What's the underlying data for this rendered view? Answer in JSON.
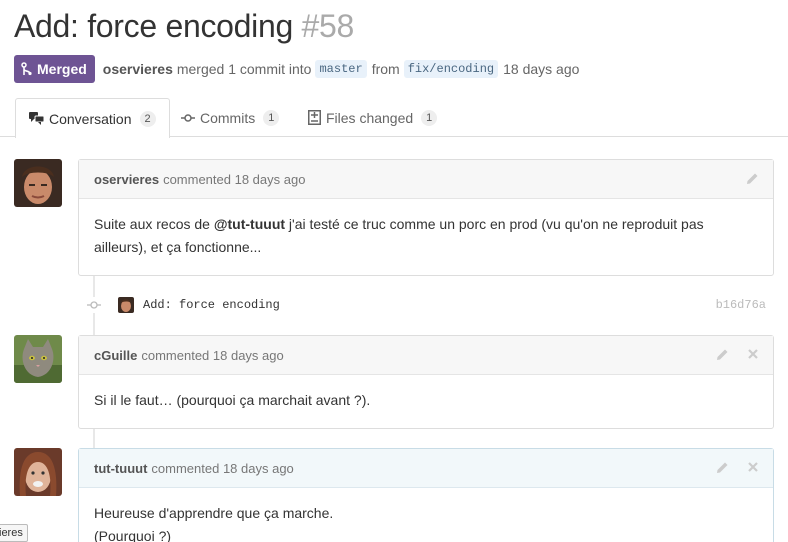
{
  "header": {
    "title": "Add: force encoding",
    "number": "#58"
  },
  "pr_meta": {
    "state": "Merged",
    "author": "oservieres",
    "text_merged": "merged 1 commit into",
    "base_branch": "master",
    "text_from": "from",
    "head_branch": "fix/encoding",
    "time": "18 days ago"
  },
  "tabs": [
    {
      "label": "Conversation",
      "count": "2",
      "icon": "comment-discussion-icon"
    },
    {
      "label": "Commits",
      "count": "1",
      "icon": "git-commit-icon"
    },
    {
      "label": "Files changed",
      "count": "1",
      "icon": "diff-icon"
    }
  ],
  "comments": [
    {
      "author": "oservieres",
      "meta": "commented 18 days ago",
      "body_prefix": "Suite aux recos de ",
      "mention": "@tut-tuuut",
      "body_suffix": " j'ai testé ce truc comme un porc en prod (vu qu'on ne reproduit pas ailleurs), et ça fonctionne..."
    },
    {
      "author": "cGuille",
      "meta": "commented 18 days ago",
      "body": "Si il le faut… (pourquoi ça marchait avant ?)."
    },
    {
      "author": "tut-tuuut",
      "meta": "commented 18 days ago",
      "body_line1": "Heureuse d'apprendre que ça marche.",
      "body_line2": "(Pourquoi ?)"
    }
  ],
  "commit": {
    "message": "Add: force encoding",
    "sha": "b16d76a"
  },
  "tooltip": "ieres",
  "colors": {
    "merged_badge": "#6e5494",
    "branch_bg": "#e8f1fa",
    "title_number": "#aaaaaa"
  }
}
